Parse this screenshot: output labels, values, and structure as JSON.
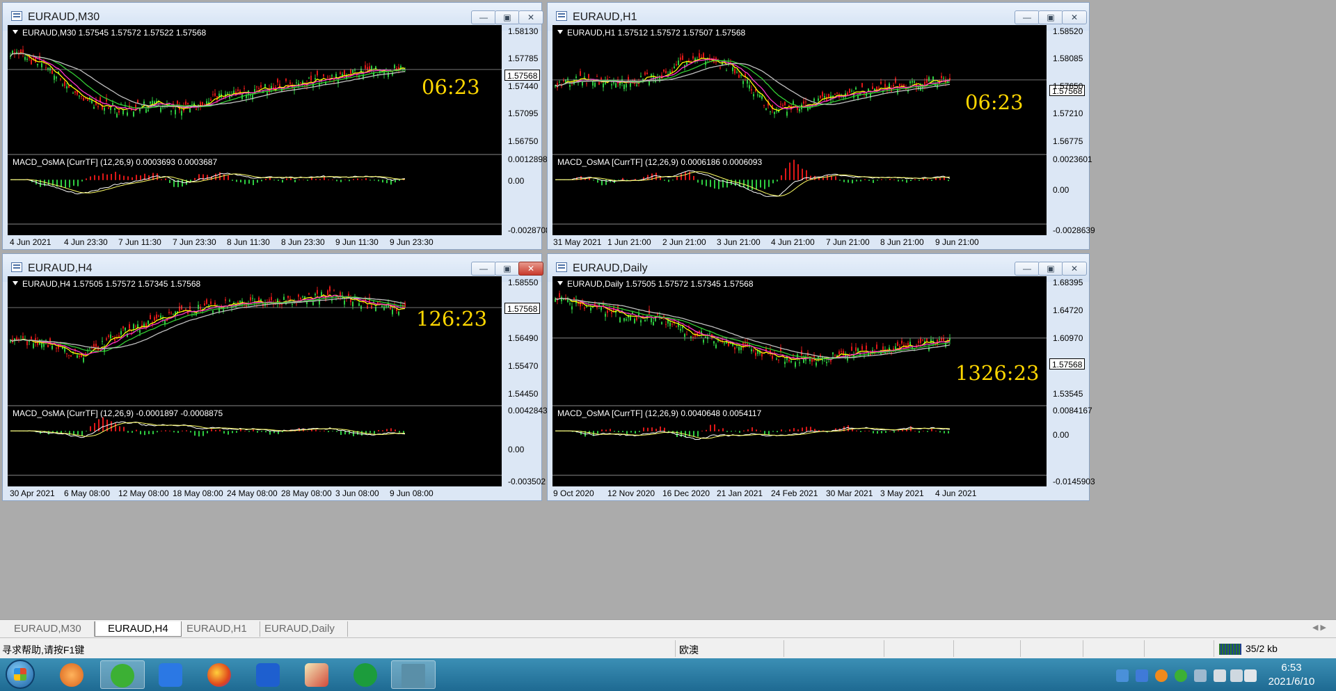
{
  "windows": [
    {
      "title": "EURAUD,M30",
      "header": "EURAUD,M30  1.57545 1.57572 1.57522 1.57568",
      "macd_label": "MACD_OsMA [CurrTF] (12,26,9) 0.0003693 0.0003687",
      "countdown": "06:23",
      "price_tag": "1.57568",
      "y_labels": [
        "1.58130",
        "1.57785",
        "1.57440",
        "1.57095",
        "1.56750"
      ],
      "macd_y_labels": [
        "0.0012898",
        "0.00",
        "-0.0028708"
      ],
      "x_labels": [
        "4 Jun 2021",
        "4 Jun 23:30",
        "7 Jun 11:30",
        "7 Jun 23:30",
        "8 Jun 11:30",
        "8 Jun 23:30",
        "9 Jun 11:30",
        "9 Jun 23:30"
      ]
    },
    {
      "title": "EURAUD,H1",
      "header": "EURAUD,H1  1.57512 1.57572 1.57507 1.57568",
      "macd_label": "MACD_OsMA [CurrTF] (12,26,9) 0.0006186 0.0006093",
      "countdown": "06:23",
      "price_tag": "1.57568",
      "y_labels": [
        "1.58520",
        "1.58085",
        "1.57650",
        "1.57210",
        "1.56775"
      ],
      "macd_y_labels": [
        "0.0023601",
        "0.00",
        "-0.0028639"
      ],
      "x_labels": [
        "31 May 2021",
        "1 Jun 21:00",
        "2 Jun 21:00",
        "3 Jun 21:00",
        "4 Jun 21:00",
        "7 Jun 21:00",
        "8 Jun 21:00",
        "9 Jun 21:00"
      ]
    },
    {
      "title": "EURAUD,H4",
      "header": "EURAUD,H4  1.57505 1.57572 1.57345 1.57568",
      "macd_label": "MACD_OsMA [CurrTF] (12,26,9) -0.0001897 -0.0008875",
      "countdown": "126:23",
      "price_tag": "1.57568",
      "y_labels": [
        "1.58550",
        "1.57568",
        "1.56490",
        "1.55470",
        "1.54450"
      ],
      "macd_y_labels": [
        "0.0042843",
        "0.00",
        "-0.003502"
      ],
      "x_labels": [
        "30 Apr 2021",
        "6 May 08:00",
        "12 May 08:00",
        "18 May 08:00",
        "24 May 08:00",
        "28 May 08:00",
        "3 Jun 08:00",
        "9 Jun 08:00"
      ]
    },
    {
      "title": "EURAUD,Daily",
      "header": "EURAUD,Daily  1.57505 1.57572 1.57345 1.57568",
      "macd_label": "MACD_OsMA [CurrTF] (12,26,9) 0.0040648 0.0054117",
      "countdown": "1326:23",
      "price_tag": "1.57568",
      "y_labels": [
        "1.68395",
        "1.64720",
        "1.60970",
        "1.57568",
        "1.53545"
      ],
      "macd_y_labels": [
        "0.0084167",
        "0.00",
        "-0.0145903"
      ],
      "x_labels": [
        "9 Oct 2020",
        "12 Nov 2020",
        "16 Dec 2020",
        "21 Jan 2021",
        "24 Feb 2021",
        "30 Mar 2021",
        "3 May 2021",
        "4 Jun 2021"
      ]
    }
  ],
  "tabs": [
    "EURAUD,M30",
    "EURAUD,H4",
    "EURAUD,H1",
    "EURAUD,Daily"
  ],
  "active_tab": "EURAUD,H4",
  "status": {
    "help": "寻求帮助,请按F1键",
    "profile": "欧澳",
    "traffic": "35/2 kb"
  },
  "clock": {
    "time": "6:53",
    "date": "2021/6/10"
  },
  "colors": {
    "bull": "#2ecc40",
    "bear": "#e01818",
    "ma_fast": "#ffff00",
    "ma_mid": "#ff33cc",
    "ma_slow": "#33cc33",
    "ma_long": "#c0c0c0",
    "countdown": "#ffd700"
  },
  "taskbar_icons": [
    "start-orb",
    "app-orange",
    "wechat",
    "pen-app",
    "firefox",
    "lanhu-app",
    "paint-app",
    "green-circle-app",
    "mt4-app"
  ],
  "tray_icons": [
    "usb-icon",
    "shield-icon",
    "orange-tray-icon",
    "wechat-tray-icon",
    "network-tray-icon",
    "flag-icon",
    "volume-icon",
    "signal-icon"
  ]
}
